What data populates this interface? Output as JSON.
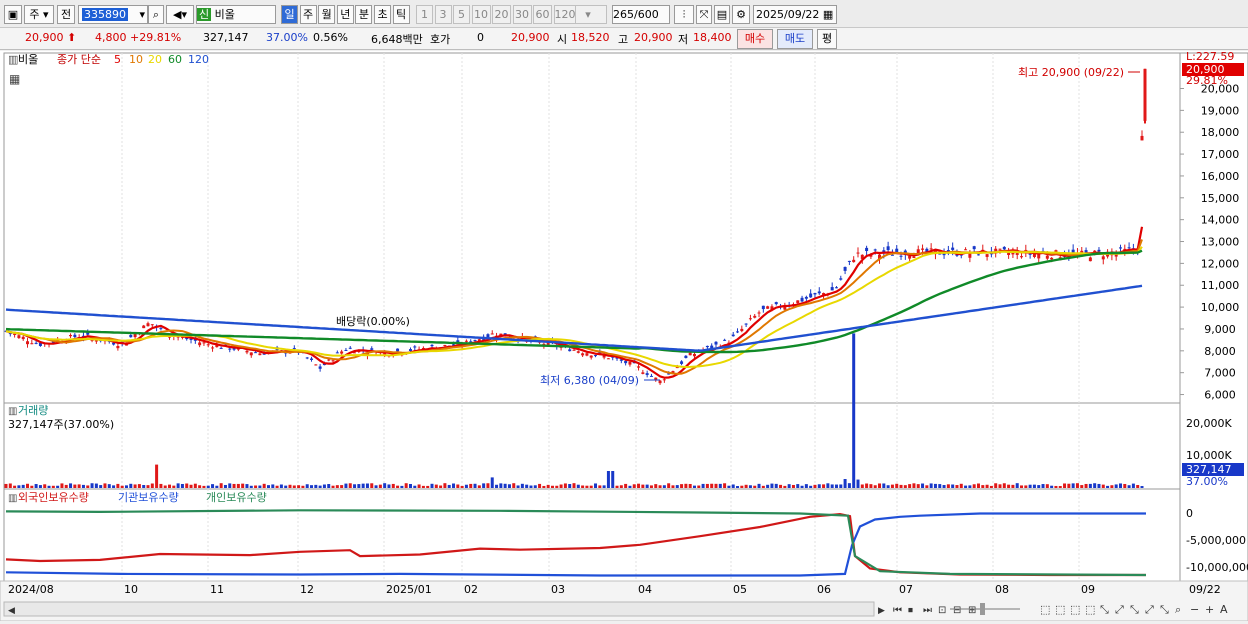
{
  "toolbar": {
    "market_label": "주",
    "prev_label": "전",
    "stock_code": "335890",
    "market_badge": "신",
    "stock_name": "비올",
    "period_buttons": [
      "일",
      "주",
      "월",
      "년",
      "분",
      "초",
      "틱"
    ],
    "active_period": "일",
    "interval_buttons": [
      "1",
      "3",
      "5",
      "10",
      "20",
      "30",
      "60",
      "120"
    ],
    "count_display": "265",
    "count_total": "/600",
    "date": "2025/09/22"
  },
  "quote": {
    "price": "20,900",
    "change": "4,800",
    "change_pct": "+29.81%",
    "volume": "327,147",
    "volume_ratio": "37.00%",
    "turnover": "0.56%",
    "amount": "6,648백만",
    "bid_label": "호가",
    "bid_value": "0",
    "bid_price": "20,900",
    "open_label": "시",
    "open": "18,520",
    "high_label": "고",
    "high": "20,900",
    "low_label": "저",
    "low": "18,400",
    "buy_label": "매수",
    "sell_label": "매도",
    "eval_label": "평"
  },
  "price_panel": {
    "legend_name": "비올",
    "ma_label": "종가 단순",
    "ma_periods": [
      "5",
      "10",
      "20",
      "60",
      "120"
    ],
    "ma_colors": [
      "#e00000",
      "#e07800",
      "#e8d800",
      "#108a28",
      "#2050d0"
    ],
    "y_ticks": [
      "20,000",
      "19,000",
      "18,000",
      "17,000",
      "16,000",
      "15,000",
      "14,000",
      "13,000",
      "12,000",
      "11,000",
      "10,000",
      "9,000",
      "8,000",
      "7,000",
      "6,000"
    ],
    "ylim": [
      5500,
      22500
    ],
    "top_scale_label": "L:227.59",
    "current_price_tag": "20,900",
    "current_pct_tag": "29.81%",
    "high_annotation": "최고 20,900 (09/22)",
    "low_annotation": "최저 6,380 (04/09)",
    "dividend_annotation": "배당락(0.00%)"
  },
  "volume_panel": {
    "title": "거래량",
    "readout": "327,147주(37.00%)",
    "y_ticks": [
      "20,000K",
      "10,000K"
    ],
    "current_tag": "327,147",
    "current_pct": "37.00%"
  },
  "holdings_panel": {
    "series_labels": [
      "외국인보유수량",
      "기관보유수량",
      "개인보유수량"
    ],
    "series_colors": [
      "#d01818",
      "#2050d8",
      "#2a8a58"
    ],
    "y_ticks": [
      "0",
      "-5,000,000",
      "-10,000,000"
    ]
  },
  "x_axis": {
    "labels": [
      "2024/08",
      "10",
      "11",
      "12",
      "2025/01",
      "02",
      "03",
      "04",
      "05",
      "06",
      "07",
      "08",
      "09",
      "09/22"
    ]
  },
  "chart_data": {
    "type": "candlestick",
    "price_series": {
      "dates": [
        "2024-08",
        "2024-09",
        "2024-10",
        "2024-11",
        "2024-12",
        "2025-01",
        "2025-02",
        "2025-03",
        "2025-04-09",
        "2025-05",
        "2025-06",
        "2025-06-20",
        "2025-07",
        "2025-08",
        "2025-09",
        "2025-09-19",
        "2025-09-22"
      ],
      "close_approx": [
        8800,
        8300,
        8700,
        8200,
        7700,
        8100,
        8400,
        8300,
        6600,
        8400,
        10800,
        12500,
        12500,
        12500,
        12500,
        16100,
        20900
      ],
      "high_marker": {
        "date": "2025-09-22",
        "value": 20900
      },
      "low_marker": {
        "date": "2025-04-09",
        "value": 6380
      }
    },
    "moving_averages": [
      {
        "name": "5",
        "values_approx": [
          8800,
          8200,
          8700,
          8100,
          7800,
          8200,
          8500,
          8200,
          6700,
          8400,
          10500,
          12500,
          12500,
          12500,
          12500,
          13500,
          14700
        ]
      },
      {
        "name": "10",
        "values_approx": [
          8700,
          8300,
          8600,
          8200,
          7900,
          8100,
          8400,
          8200,
          6900,
          8300,
          10300,
          12200,
          12500,
          12500,
          12500,
          13000,
          13700
        ]
      },
      {
        "name": "20",
        "values_approx": [
          8600,
          8400,
          8500,
          8200,
          8000,
          8100,
          8300,
          8200,
          7200,
          7900,
          9900,
          11400,
          12400,
          12500,
          12500,
          12600,
          13000
        ]
      },
      {
        "name": "60",
        "values_approx": [
          9000,
          8700,
          8500,
          8300,
          8200,
          8100,
          8200,
          8100,
          8000,
          8000,
          8600,
          9700,
          11000,
          11900,
          12300,
          12500,
          12600
        ]
      },
      {
        "name": "120",
        "values_approx": [
          9900,
          9600,
          9300,
          9000,
          8700,
          8500,
          8300,
          8100,
          8000,
          7900,
          8200,
          8600,
          9200,
          9800,
          10400,
          10800,
          11000
        ]
      }
    ],
    "volume_peaks": [
      {
        "date": "2024-10",
        "value_k": 7000
      },
      {
        "date": "2025-03",
        "value_k": 5000
      },
      {
        "date": "2025-06-20",
        "value_k": 20000
      }
    ],
    "holdings": [
      {
        "name": "외국인보유수량",
        "start": -8500000,
        "pre_break": -200000,
        "end": -11500000
      },
      {
        "name": "기관보유수량",
        "start": -11000000,
        "pre_break": -11500000,
        "end": 0
      },
      {
        "name": "개인보유수량",
        "start": 200000,
        "pre_break": -200000,
        "end": -11500000
      }
    ]
  }
}
